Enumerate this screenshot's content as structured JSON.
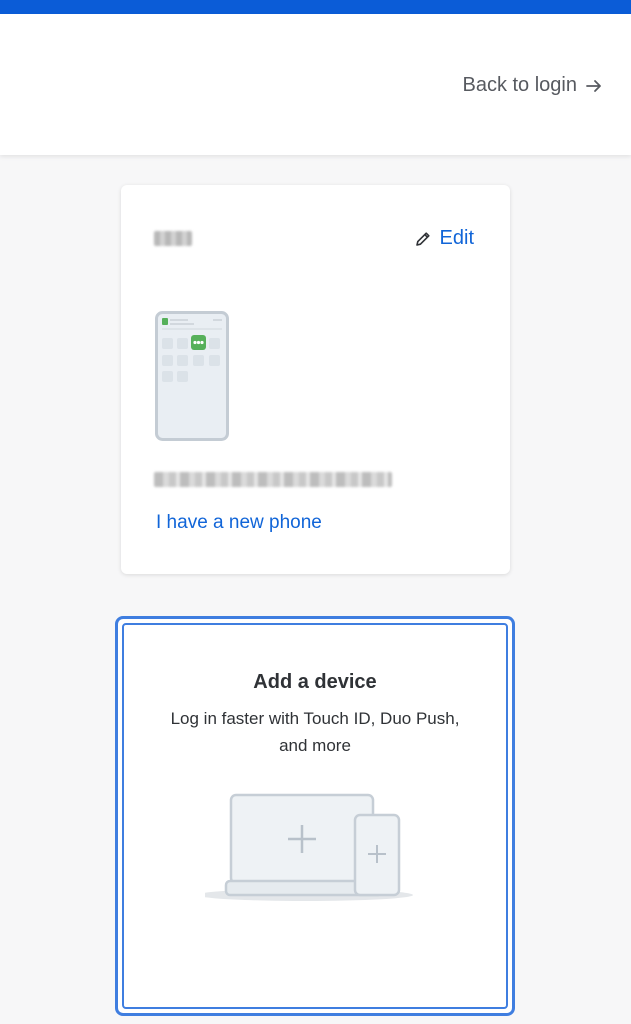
{
  "header": {
    "back_label": "Back to login",
    "back_icon": "arrow-right-icon",
    "accent_color": "#0b5cd7"
  },
  "device_card": {
    "edit_label": "Edit",
    "edit_icon": "pencil-icon",
    "new_phone_label": "I have a new phone",
    "link_color": "#1165d8"
  },
  "add_device": {
    "title": "Add a device",
    "subtitle": "Log in faster with Touch ID, Duo Push, and more",
    "border_color": "#3f7ee0"
  }
}
